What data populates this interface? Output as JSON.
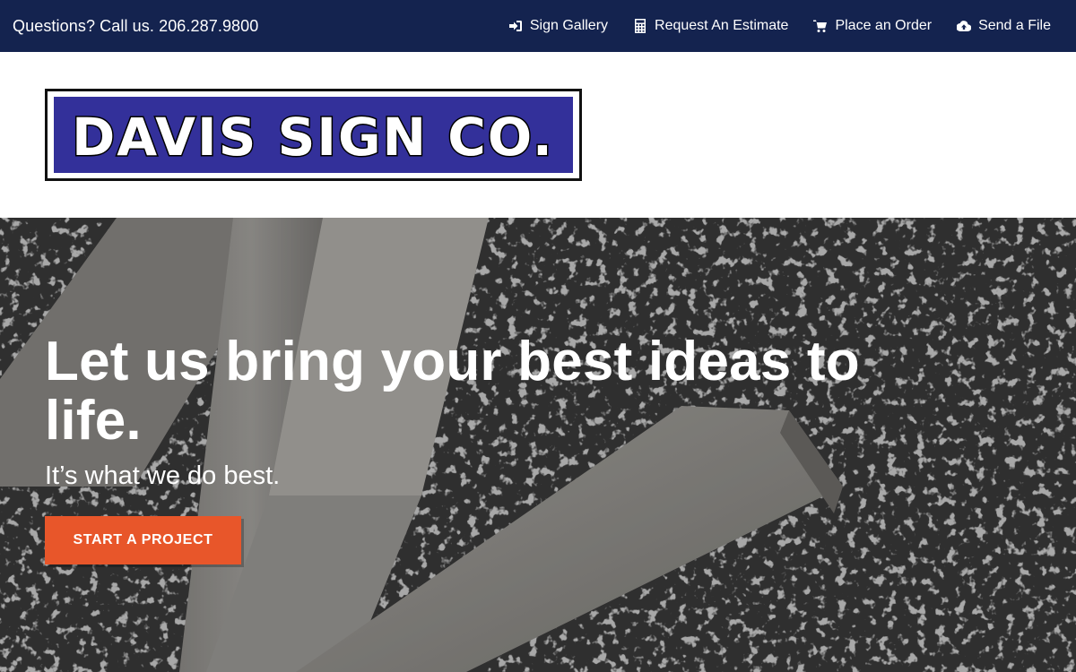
{
  "topbar": {
    "phone_text": "Questions? Call us. 206.287.9800",
    "nav": [
      {
        "label": "Sign Gallery",
        "icon": "sign-in-icon"
      },
      {
        "label": "Request An Estimate",
        "icon": "calculator-icon"
      },
      {
        "label": "Place an Order",
        "icon": "shopping-cart-icon"
      },
      {
        "label": "Send a File",
        "icon": "cloud-upload-icon"
      }
    ]
  },
  "header": {
    "logo_text": "DAVIS SIGN CO."
  },
  "hero": {
    "headline": "Let us bring your best ideas to life.",
    "subtitle": "It’s what we do best.",
    "cta_label": "START A PROJECT"
  },
  "colors": {
    "topbar_bg": "#14234f",
    "logo_blue": "#33309a",
    "cta_orange": "#e8562a"
  }
}
